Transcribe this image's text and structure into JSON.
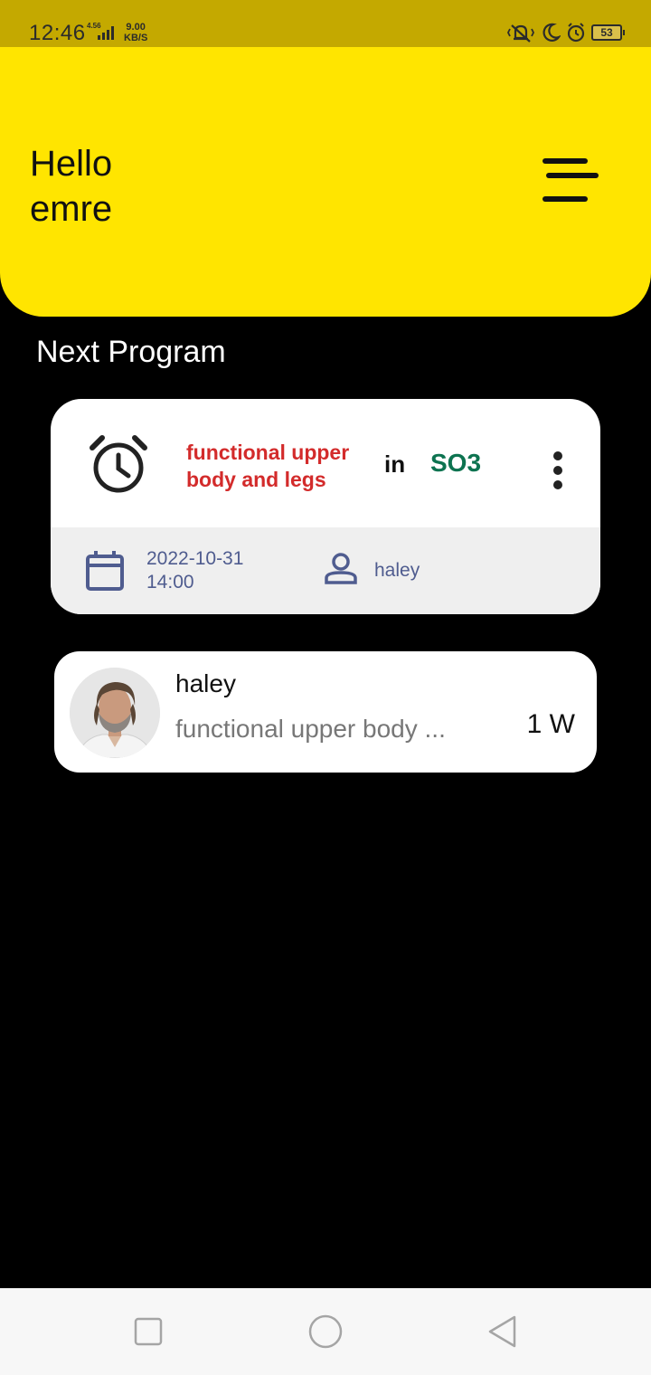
{
  "status_bar": {
    "time": "12:46",
    "network_label": "4.56",
    "speed_value": "9.00",
    "speed_unit": "KB/S",
    "battery": "53",
    "icons": [
      "vibrate-icon",
      "moon-icon",
      "alarm-icon",
      "battery-icon"
    ]
  },
  "header": {
    "greeting_line1": "Hello",
    "greeting_line2": "emre",
    "menu_icon": "menu-icon",
    "background_color": "#ffe500"
  },
  "next_program": {
    "section_title": "Next Program",
    "program_name": "functional upper body and legs",
    "in_label": "in",
    "room": "SO3",
    "date": "2022-10-31",
    "time": "14:00",
    "coach": "haley",
    "colors": {
      "program_name": "#d32b2b",
      "room": "#0d7350",
      "meta": "#4f5c8f"
    }
  },
  "coach_card": {
    "name": "haley",
    "program": "functional upper body ...",
    "duration": "1 W"
  },
  "nav_bar": {
    "buttons": [
      "recents-square-icon",
      "home-circle-icon",
      "back-triangle-icon"
    ]
  }
}
